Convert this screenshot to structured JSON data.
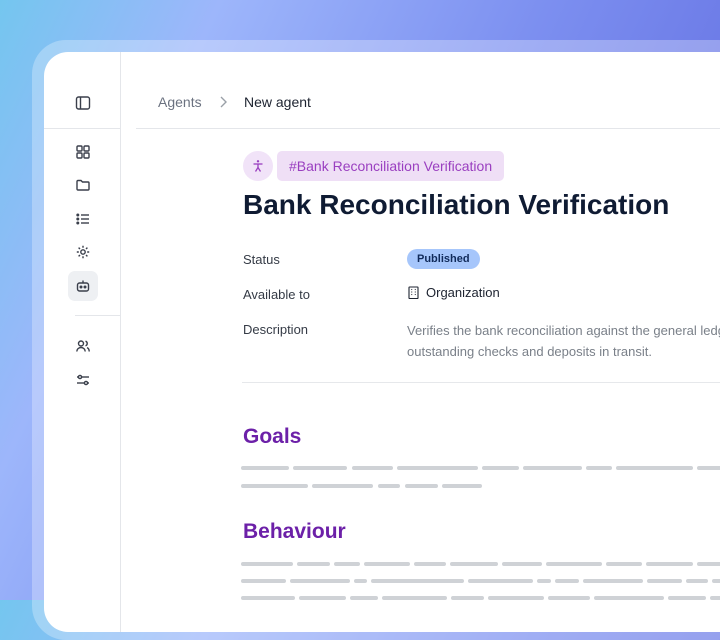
{
  "breadcrumb": {
    "items": [
      "Agents",
      "New agent"
    ],
    "separator": ">"
  },
  "sidebar": {
    "icons": [
      "panel-toggle-icon",
      "dashboard-icon",
      "folder-icon",
      "list-icon",
      "settings-icon",
      "bot-icon",
      "users-icon",
      "sliders-icon"
    ],
    "active": "bot-icon"
  },
  "agent": {
    "tag": "#Bank Reconciliation Verification",
    "title": "Bank Reconciliation Verification",
    "fields": {
      "status_label": "Status",
      "status_value": "Published",
      "available_label": "Available to",
      "available_value": "Organization",
      "description_label": "Description",
      "description_value": "Verifies the bank reconciliation against the general ledger, including outstanding checks and deposits in transit."
    }
  },
  "sections": {
    "goals": "Goals",
    "behaviour": "Behaviour"
  },
  "colors": {
    "accent_purple": "#6c20a8",
    "tag_bg": "#efdff6",
    "badge_bg": "#a6c6fb"
  }
}
